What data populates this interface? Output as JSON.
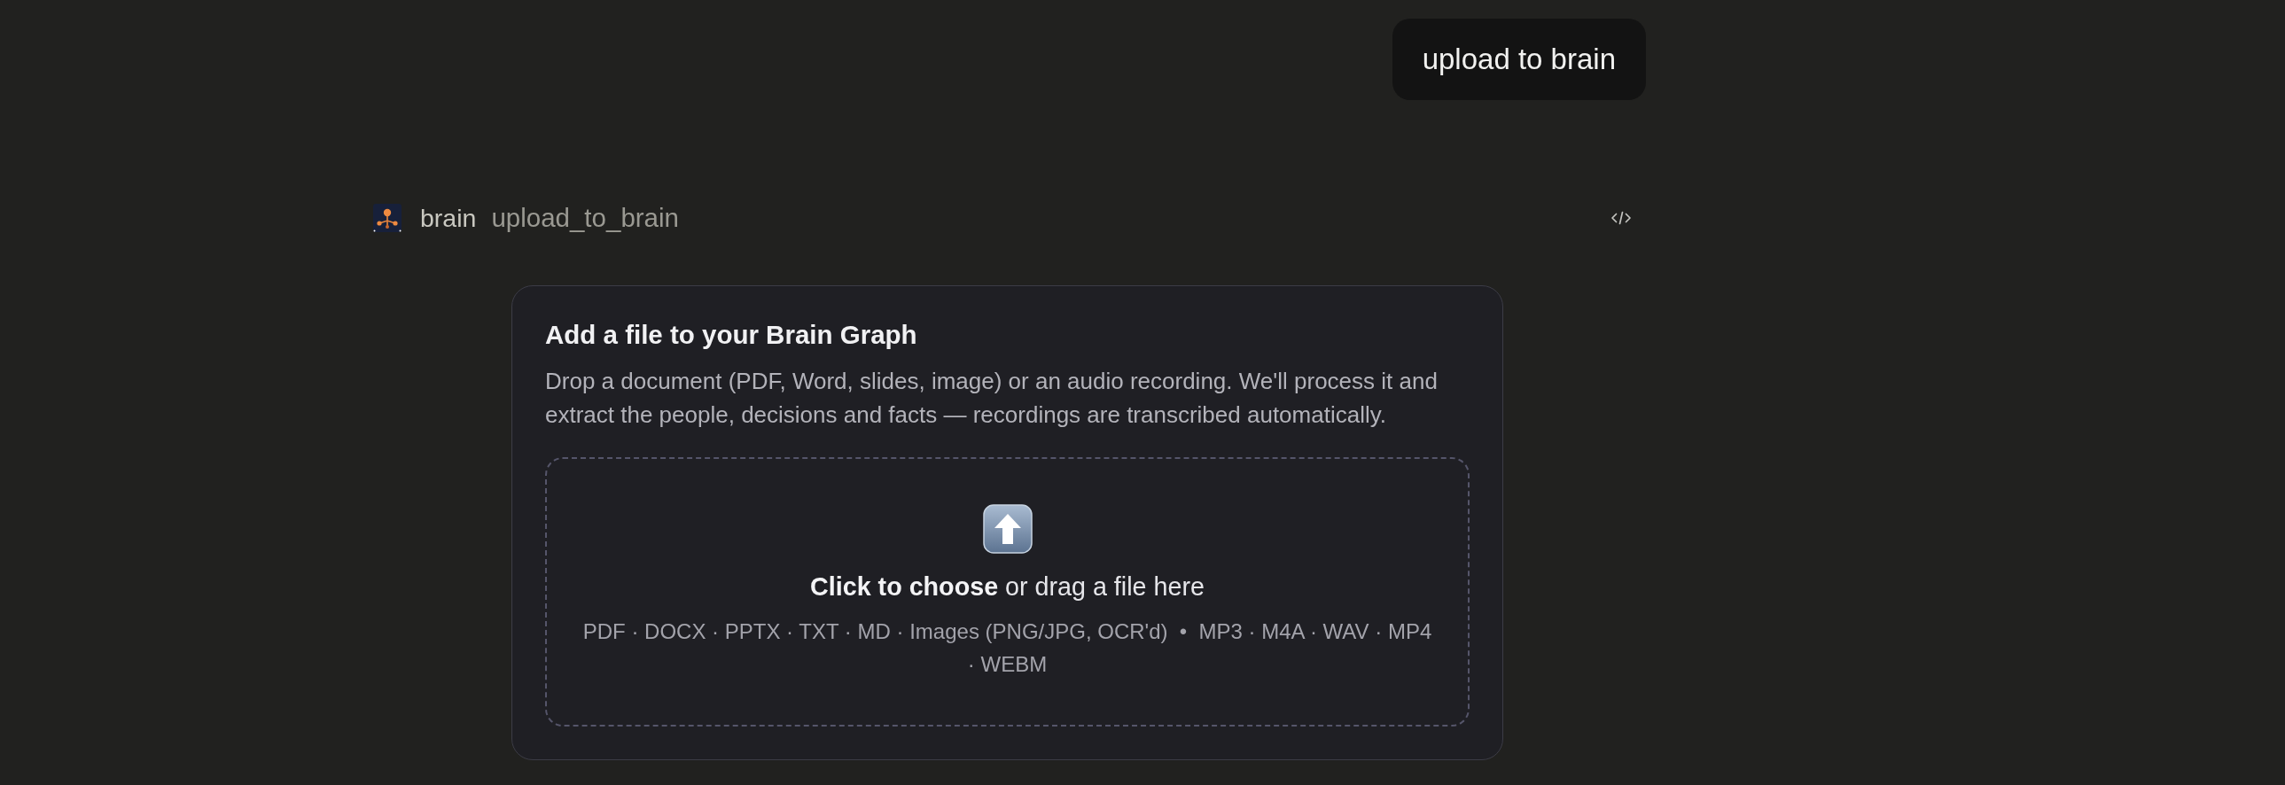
{
  "user_message": {
    "text": "upload to brain"
  },
  "tool_call": {
    "agent": "brain",
    "tool": "upload_to_brain"
  },
  "upload_card": {
    "title": "Add a file to your Brain Graph",
    "description": "Drop a document (PDF, Word, slides, image) or an audio recording. We'll process it and extract the people, decisions and facts — recordings are transcribed automatically.",
    "dropzone": {
      "prompt": "**Click to choose** or drag a file here",
      "formats": "PDF · DOCX · PPTX · TXT · MD · Images (PNG/JPG, OCR'd)  •  MP3 · M4A · WAV · MP4 · WEBM"
    }
  }
}
